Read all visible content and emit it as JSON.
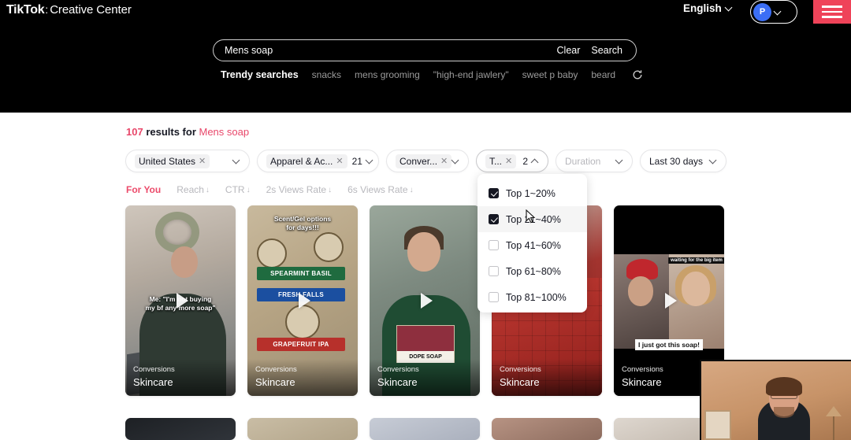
{
  "header": {
    "brand_tiktok": "TikTok",
    "brand_separator": ":",
    "brand_name": "Creative Center",
    "language": "English",
    "avatar_initial": "P",
    "menu_icon": "hamburger-icon"
  },
  "search": {
    "value": "Mens soap",
    "placeholder": "Search",
    "clear_label": "Clear",
    "search_label": "Search",
    "trendy_label": "Trendy searches",
    "trendy_items": [
      "snacks",
      "mens grooming",
      "\"high-end jawlery\"",
      "sweet p baby",
      "beard"
    ],
    "refresh_icon": "refresh-icon"
  },
  "results": {
    "count": "107",
    "middle_text": " results for ",
    "term": "Mens soap"
  },
  "filters": [
    {
      "name": "country",
      "label": "United States",
      "tag": "United States",
      "removable": true,
      "count": "",
      "state": "normal",
      "chevron": "down"
    },
    {
      "name": "category",
      "label": "Apparel & Ac...",
      "tag": "Apparel & Ac...",
      "removable": true,
      "count": "21",
      "state": "normal",
      "chevron": "down"
    },
    {
      "name": "objective",
      "label": "Conver...",
      "tag": "Conver...",
      "removable": true,
      "count": "",
      "state": "normal",
      "chevron": "down"
    },
    {
      "name": "top-range",
      "label": "T...",
      "tag": "T...",
      "removable": true,
      "count": "2",
      "state": "active",
      "chevron": "up"
    },
    {
      "name": "duration",
      "label": "Duration",
      "tag": "",
      "removable": false,
      "count": "",
      "state": "disabled",
      "chevron": "down"
    },
    {
      "name": "date",
      "label": "Last 30 days",
      "tag": "",
      "removable": false,
      "count": "",
      "state": "normal",
      "chevron": "down"
    }
  ],
  "dropdown": {
    "open_for": "top-range",
    "items": [
      {
        "label": "Top 1~20%",
        "checked": true,
        "hovered": false
      },
      {
        "label": "Top 21~40%",
        "checked": true,
        "hovered": true
      },
      {
        "label": "Top 41~60%",
        "checked": false,
        "hovered": false
      },
      {
        "label": "Top 61~80%",
        "checked": false,
        "hovered": false
      },
      {
        "label": "Top 81~100%",
        "checked": false,
        "hovered": false
      }
    ]
  },
  "sorts": [
    {
      "label": "For You",
      "arrow": "",
      "active": true
    },
    {
      "label": "Reach",
      "arrow": "↓",
      "active": false
    },
    {
      "label": "CTR",
      "arrow": "↓",
      "active": false
    },
    {
      "label": "2s Views Rate",
      "arrow": "↓",
      "active": false
    },
    {
      "label": "6s Views Rate",
      "arrow": "↓",
      "active": false
    }
  ],
  "cards": [
    {
      "objective": "Conversions",
      "category": "Skincare",
      "art": "art-room",
      "caption_line1": "Me: \"I'm not buying",
      "caption_line2": "my bf any more soap\""
    },
    {
      "objective": "Conversions",
      "category": "Skincare",
      "art": "art-boxes",
      "caption_line1": "Scent/Gel options",
      "caption_line2": "for days!!!",
      "band_green": "SPEARMINT BASIL",
      "band_blue": "FRESH FALLS",
      "band_red": "GRAPEFRUIT IPA"
    },
    {
      "objective": "Conversions",
      "category": "Skincare",
      "art": "art-porch",
      "box_label": "DOPE SOAP"
    },
    {
      "objective": "Conversions",
      "category": "Skincare",
      "art": "art-red"
    },
    {
      "objective": "Conversions",
      "category": "Skincare",
      "art": "art-split",
      "caption_box": "I just got this soap!",
      "caption_small": "waiting for the big item"
    }
  ],
  "cards_row2": [
    {
      "art": "art-gray"
    },
    {
      "art": "art-wood"
    },
    {
      "art": "art-blue"
    },
    {
      "art": "art-skin"
    },
    {
      "art": "art-light"
    }
  ],
  "colors": {
    "brand_red": "#ef4359",
    "accent_pink": "#e8476a",
    "header_bg": "#000000",
    "page_bg": "#ffffff",
    "avatar_blue": "#3b6ef5"
  }
}
